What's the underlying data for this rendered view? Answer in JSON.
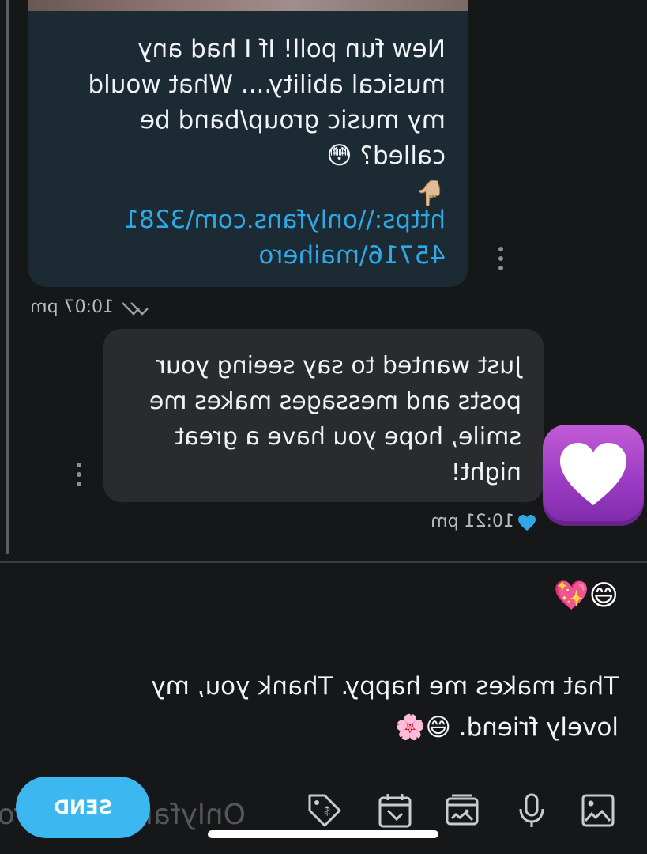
{
  "incoming_message": {
    "text": "New fun poll! If I had any musical ability.... What would my music group/band be called? 😳",
    "pointer_emoji": "👇🏼",
    "link": "https:\\\\onlyfans.com\\328145716\\maihero",
    "time": "10:07 pm"
  },
  "outgoing_message": {
    "text": "Just wanted to say seeing your posts and messages makes me smile, hope you have a great night!",
    "time": "10:21 pm",
    "reaction_sticker": "purple-heart-sticker"
  },
  "compose": {
    "emojis": "😄💖",
    "draft_text": "That makes me happy. Thank you, my lovely friend. 😄🌸"
  },
  "toolbar": {
    "send_label": "SEND",
    "icons": [
      "image-icon",
      "microphone-icon",
      "vault-icon",
      "schedule-icon",
      "price-tag-icon"
    ]
  },
  "watermark": "Onlyfans Maihero",
  "colors": {
    "background": "#161719",
    "incoming_bubble": "#1b2a33",
    "outgoing_bubble": "#2a2b2e",
    "link": "#2ea8e6",
    "accent": "#3db7f0"
  }
}
